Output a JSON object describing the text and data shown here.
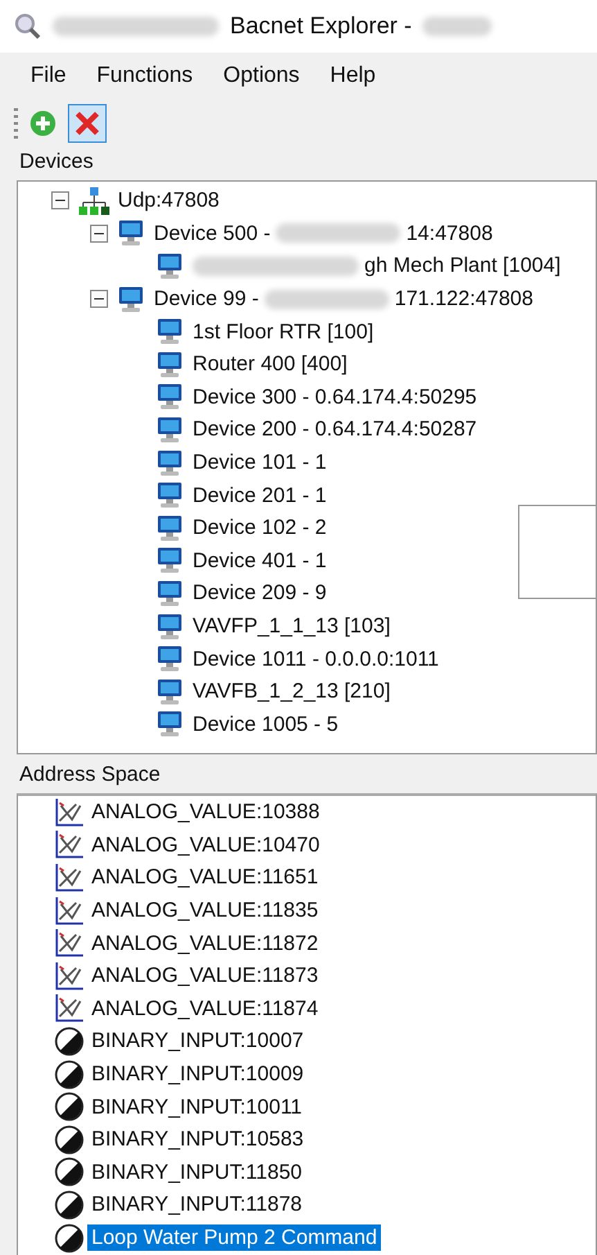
{
  "window": {
    "title": "Bacnet Explorer -"
  },
  "menu": [
    {
      "label": "File"
    },
    {
      "label": "Functions"
    },
    {
      "label": "Options"
    },
    {
      "label": "Help"
    }
  ],
  "toolbar": [
    {
      "kind": "add",
      "highlighted": false
    },
    {
      "kind": "delete",
      "highlighted": true
    }
  ],
  "devices": {
    "title": "Devices",
    "tree": [
      {
        "kind": "network",
        "label": "Udp:47808",
        "expanded": true,
        "children": [
          {
            "kind": "device",
            "label": "Device 500 -",
            "label_end": "14:47808",
            "expanded": true,
            "children": [
              {
                "kind": "device",
                "label_end": "gh Mech Plant [1004]"
              }
            ]
          },
          {
            "kind": "device",
            "label": "Device 99 -",
            "label_end": "171.122:47808",
            "expanded": true,
            "children": [
              {
                "kind": "device",
                "label": "1st Floor RTR [100]"
              },
              {
                "kind": "device",
                "label": "Router 400 [400]"
              },
              {
                "kind": "device",
                "label": "Device 300 - 0.64.174.4:50295"
              },
              {
                "kind": "device",
                "label": "Device 200 - 0.64.174.4:50287"
              },
              {
                "kind": "device",
                "label": "Device 101 - 1"
              },
              {
                "kind": "device",
                "label": "Device 201 - 1"
              },
              {
                "kind": "device",
                "label": "Device 102 - 2"
              },
              {
                "kind": "device",
                "label": "Device 401 - 1"
              },
              {
                "kind": "device",
                "label": "Device 209 - 9"
              },
              {
                "kind": "device",
                "label": "VAVFP_1_1_13 [103]"
              },
              {
                "kind": "device",
                "label": "Device 1011 - 0.0.0.0:1011"
              },
              {
                "kind": "device",
                "label": "VAVFB_1_2_13 [210]"
              },
              {
                "kind": "device",
                "label": "Device 1005 - 5"
              }
            ]
          }
        ]
      }
    ]
  },
  "address_space": {
    "title": "Address Space",
    "items": [
      {
        "kind": "analog",
        "label": "ANALOG_VALUE:10388",
        "selected": false
      },
      {
        "kind": "analog",
        "label": "ANALOG_VALUE:10470",
        "selected": false
      },
      {
        "kind": "analog",
        "label": "ANALOG_VALUE:11651",
        "selected": false
      },
      {
        "kind": "analog",
        "label": "ANALOG_VALUE:11835",
        "selected": false
      },
      {
        "kind": "analog",
        "label": "ANALOG_VALUE:11872",
        "selected": false
      },
      {
        "kind": "analog",
        "label": "ANALOG_VALUE:11873",
        "selected": false
      },
      {
        "kind": "analog",
        "label": "ANALOG_VALUE:11874",
        "selected": false
      },
      {
        "kind": "binary",
        "label": "BINARY_INPUT:10007",
        "selected": false
      },
      {
        "kind": "binary",
        "label": "BINARY_INPUT:10009",
        "selected": false
      },
      {
        "kind": "binary",
        "label": "BINARY_INPUT:10011",
        "selected": false
      },
      {
        "kind": "binary",
        "label": "BINARY_INPUT:10583",
        "selected": false
      },
      {
        "kind": "binary",
        "label": "BINARY_INPUT:11850",
        "selected": false
      },
      {
        "kind": "binary",
        "label": "BINARY_INPUT:11878",
        "selected": false
      },
      {
        "kind": "binary",
        "label": "Loop Water  Pump 2 Command",
        "selected": true
      }
    ]
  }
}
